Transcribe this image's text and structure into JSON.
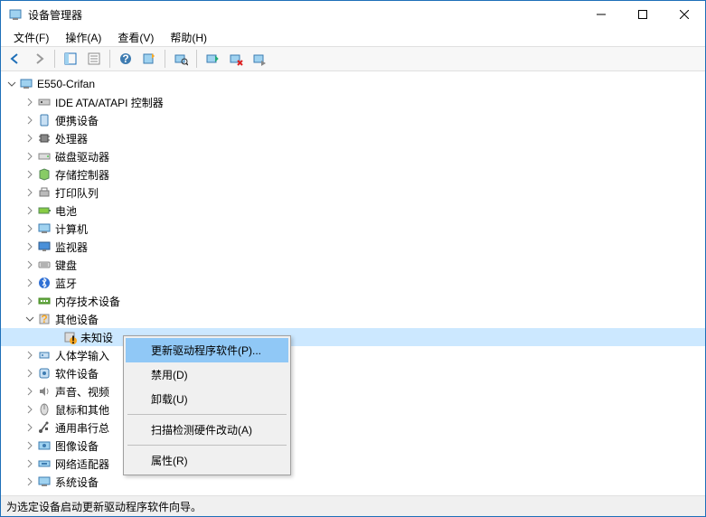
{
  "title": "设备管理器",
  "menu": {
    "file": "文件(F)",
    "action": "操作(A)",
    "view": "查看(V)",
    "help": "帮助(H)"
  },
  "tree": {
    "root": "E550-Crifan",
    "nodes": [
      {
        "label": "IDE ATA/ATAPI 控制器"
      },
      {
        "label": "便携设备"
      },
      {
        "label": "处理器"
      },
      {
        "label": "磁盘驱动器"
      },
      {
        "label": "存储控制器"
      },
      {
        "label": "打印队列"
      },
      {
        "label": "电池"
      },
      {
        "label": "计算机"
      },
      {
        "label": "监视器"
      },
      {
        "label": "键盘"
      },
      {
        "label": "蓝牙"
      },
      {
        "label": "内存技术设备"
      },
      {
        "label": "其他设备",
        "expanded": true
      },
      {
        "label": "未知设",
        "indent": true,
        "selected": true,
        "warn": true
      },
      {
        "label": "人体学输入"
      },
      {
        "label": "软件设备"
      },
      {
        "label": "声音、视频"
      },
      {
        "label": "鼠标和其他"
      },
      {
        "label": "通用串行总"
      },
      {
        "label": "图像设备"
      },
      {
        "label": "网络适配器"
      },
      {
        "label": "系统设备"
      }
    ]
  },
  "context_menu": {
    "update": "更新驱动程序软件(P)...",
    "disable": "禁用(D)",
    "uninstall": "卸载(U)",
    "scan": "扫描检测硬件改动(A)",
    "properties": "属性(R)"
  },
  "statusbar": "为选定设备启动更新驱动程序软件向导。"
}
